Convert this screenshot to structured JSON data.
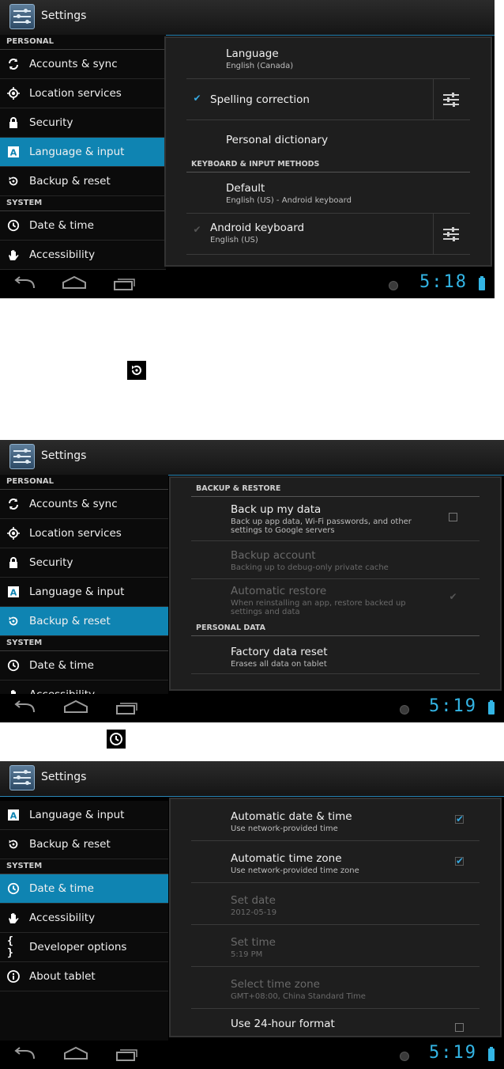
{
  "app_title": "Settings",
  "screen1": {
    "sidebar": [
      {
        "type": "header",
        "label": "PERSONAL"
      },
      {
        "type": "item",
        "icon": "sync-icon",
        "label": "Accounts & sync"
      },
      {
        "type": "item",
        "icon": "location-icon",
        "label": "Location services"
      },
      {
        "type": "item",
        "icon": "lock-icon",
        "label": "Security"
      },
      {
        "type": "item",
        "icon": "language-icon",
        "label": "Language & input",
        "selected": true
      },
      {
        "type": "item",
        "icon": "backup-icon",
        "label": "Backup & reset"
      },
      {
        "type": "header",
        "label": "SYSTEM"
      },
      {
        "type": "item",
        "icon": "clock-icon",
        "label": "Date & time"
      },
      {
        "type": "item",
        "icon": "hand-icon",
        "label": "Accessibility"
      }
    ],
    "rows": {
      "language": {
        "title": "Language",
        "summary": "English (Canada)"
      },
      "spelling": {
        "title": "Spelling correction"
      },
      "dictionary": {
        "title": "Personal dictionary"
      },
      "section": "KEYBOARD & INPUT METHODS",
      "default": {
        "title": "Default",
        "summary": "English (US) - Android keyboard"
      },
      "android_kb": {
        "title": "Android keyboard",
        "summary": "English (US)"
      }
    },
    "clock": "5:18"
  },
  "screen2": {
    "sidebar": [
      {
        "type": "header",
        "label": "PERSONAL"
      },
      {
        "type": "item",
        "icon": "sync-icon",
        "label": "Accounts & sync"
      },
      {
        "type": "item",
        "icon": "location-icon",
        "label": "Location services"
      },
      {
        "type": "item",
        "icon": "lock-icon",
        "label": "Security"
      },
      {
        "type": "item",
        "icon": "language-icon",
        "label": "Language & input"
      },
      {
        "type": "item",
        "icon": "backup-icon",
        "label": "Backup & reset",
        "selected": true
      },
      {
        "type": "header",
        "label": "SYSTEM"
      },
      {
        "type": "item",
        "icon": "clock-icon",
        "label": "Date & time"
      },
      {
        "type": "item",
        "icon": "hand-icon",
        "label": "Accessibility"
      }
    ],
    "rows": {
      "section1": "BACKUP & RESTORE",
      "backup": {
        "title": "Back up my data",
        "summary": "Back up app data, Wi-Fi passwords, and other settings to Google servers"
      },
      "account": {
        "title": "Backup account",
        "summary": "Backing up to debug-only private cache"
      },
      "restore": {
        "title": "Automatic restore",
        "summary": "When reinstalling an app, restore backed up settings and data"
      },
      "section2": "PERSONAL DATA",
      "factory": {
        "title": "Factory data reset",
        "summary": "Erases all data on tablet"
      }
    },
    "clock": "5:19"
  },
  "screen3": {
    "sidebar": [
      {
        "type": "item",
        "icon": "language-icon",
        "label": "Language & input"
      },
      {
        "type": "item",
        "icon": "backup-icon",
        "label": "Backup & reset"
      },
      {
        "type": "header",
        "label": "SYSTEM"
      },
      {
        "type": "item",
        "icon": "clock-icon",
        "label": "Date & time",
        "selected": true
      },
      {
        "type": "item",
        "icon": "hand-icon",
        "label": "Accessibility"
      },
      {
        "type": "item",
        "icon": "braces-icon",
        "label": "Developer options"
      },
      {
        "type": "item",
        "icon": "info-icon",
        "label": "About tablet"
      }
    ],
    "rows": {
      "auto_dt": {
        "title": "Automatic date & time",
        "summary": "Use network-provided time"
      },
      "auto_tz": {
        "title": "Automatic time zone",
        "summary": "Use network-provided time zone"
      },
      "set_date": {
        "title": "Set date",
        "summary": "2012-05-19"
      },
      "set_time": {
        "title": "Set time",
        "summary": "5:19 PM"
      },
      "select_tz": {
        "title": "Select time zone",
        "summary": "GMT+08:00, China Standard Time"
      },
      "h24": {
        "title": "Use 24-hour format"
      }
    },
    "clock": "5:19"
  },
  "colors": {
    "accent": "#33b5e5",
    "selected": "#0f84b2",
    "bg": "#000000"
  }
}
